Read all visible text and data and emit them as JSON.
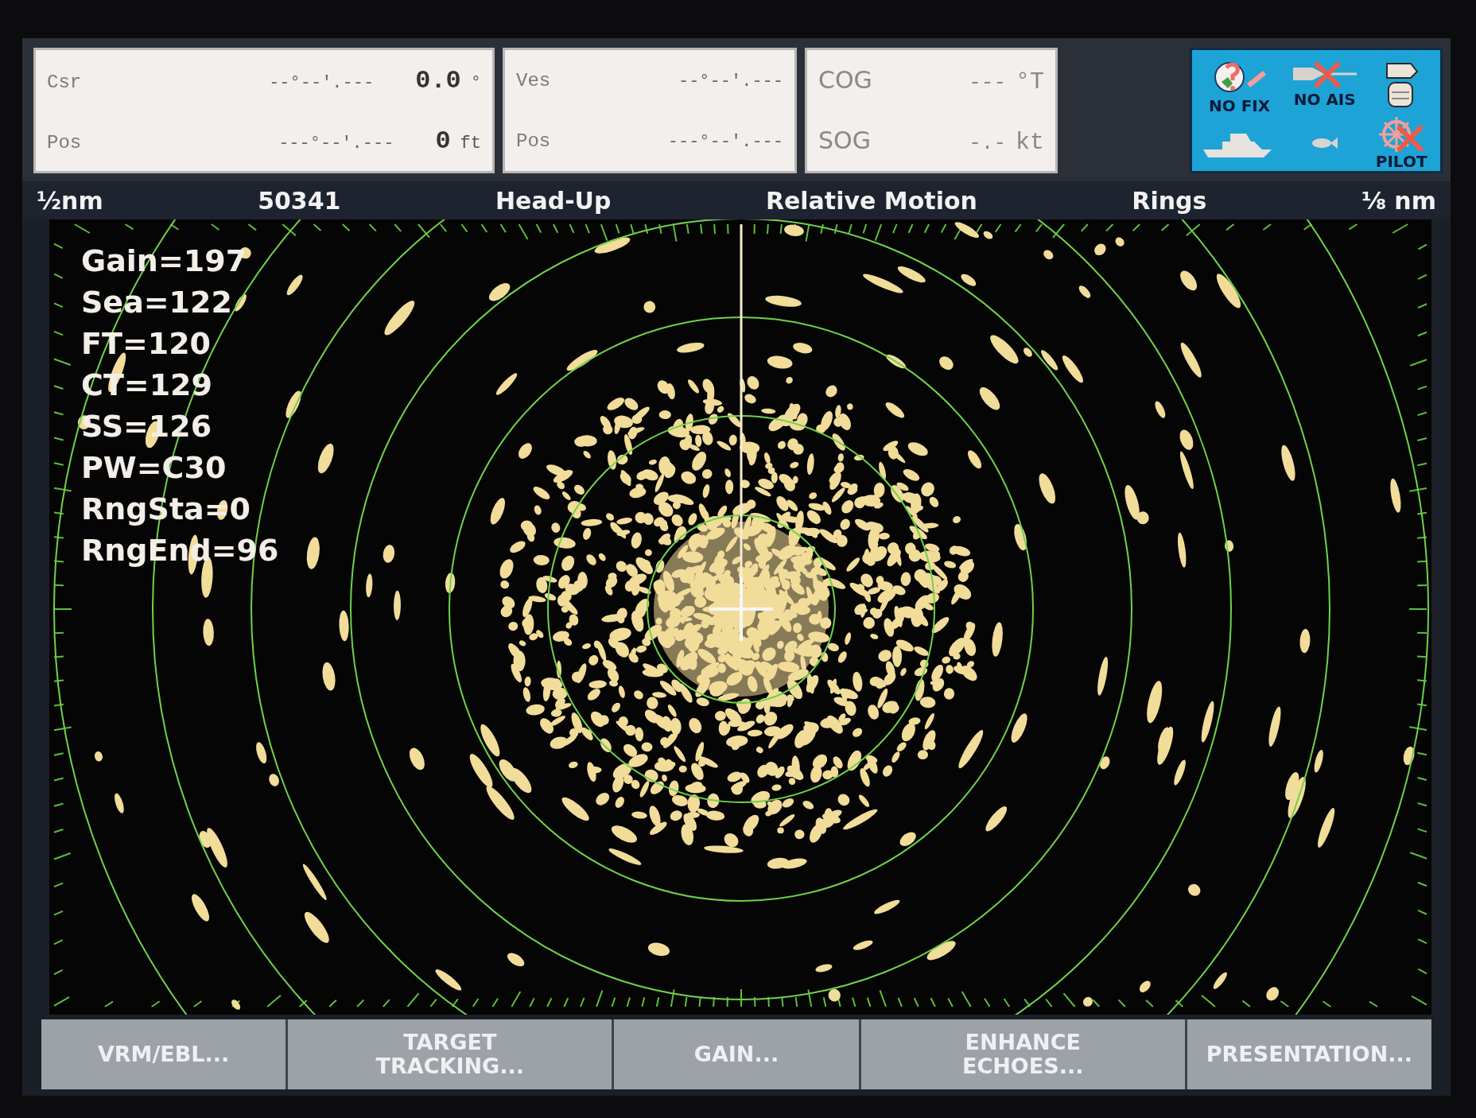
{
  "nav_panels": [
    {
      "rows": [
        {
          "label": "Csr",
          "coord": "--°--'.---",
          "value": "0.0",
          "unit": "°"
        },
        {
          "label": "Pos",
          "coord": "---°--'.---",
          "value": "0",
          "unit": "ft"
        }
      ]
    },
    {
      "rows": [
        {
          "label": "Ves",
          "coord": "--°--'.---"
        },
        {
          "label": "Pos",
          "coord": "---°--'.---"
        }
      ]
    },
    {
      "rows": [
        {
          "label": "COG",
          "value": "---",
          "unit": "°T"
        },
        {
          "label": "SOG",
          "value": "-.-",
          "unit": "kt"
        }
      ]
    }
  ],
  "status_icons": [
    {
      "kind": "fix",
      "label": "NO FIX"
    },
    {
      "kind": "ais",
      "label": "NO AIS"
    },
    {
      "kind": "scanner"
    },
    {
      "kind": "boat"
    },
    {
      "kind": "fish"
    },
    {
      "kind": "pilot",
      "label": "PILOT"
    }
  ],
  "status_bar": [
    "½nm",
    "50341",
    "Head-Up",
    "Relative Motion",
    "Rings",
    "⅛ nm"
  ],
  "readouts": [
    "Gain=197",
    "Sea=122",
    "FT=120",
    "CT=129",
    "SS=126",
    "PW=C30",
    "RngSta=0",
    "RngEnd=96"
  ],
  "softkeys": [
    "VRM/EBL...",
    "TARGET TRACKING...",
    "GAIN...",
    "ENHANCE ECHOES...",
    "PRESENTATION..."
  ]
}
